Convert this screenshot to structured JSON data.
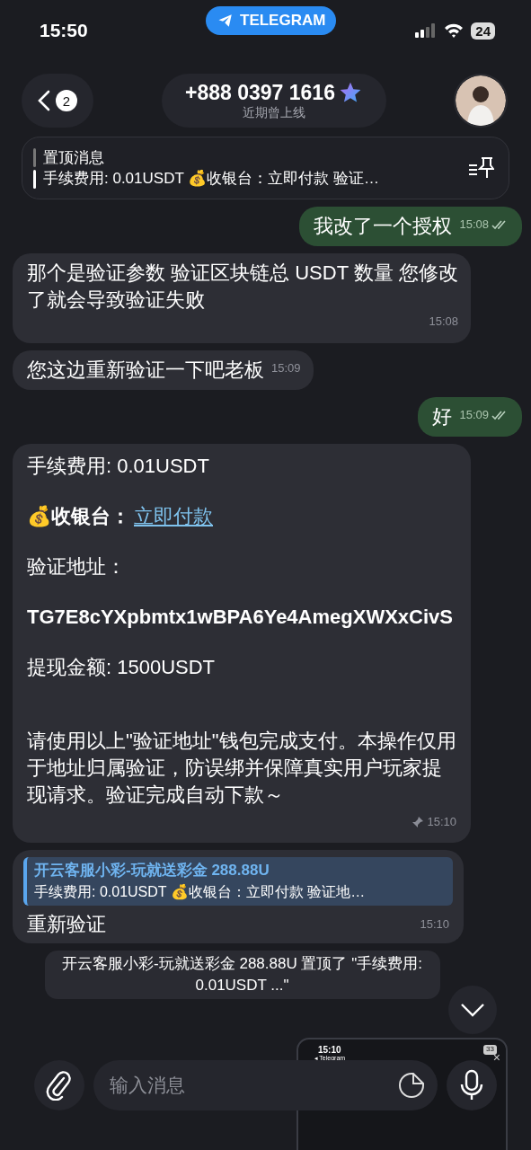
{
  "status_bar": {
    "time": "15:50",
    "app_pill": "TELEGRAM",
    "battery": "24"
  },
  "header": {
    "back_count": "2",
    "title": "+888 0397 1616",
    "subtitle": "近期曾上线"
  },
  "pinned": {
    "label": "置顶消息",
    "text": "手续费用: 0.01USDT 💰收银台：立即付款 验证…"
  },
  "messages": [
    {
      "kind": "text",
      "outgoing": true,
      "text": "我改了一个授权",
      "time": "15:08",
      "read": true
    },
    {
      "kind": "text",
      "outgoing": false,
      "text": "那个是验证参数  验证区块链总 USDT 数量 您修改了就会导致验证失败",
      "time": "15:08"
    },
    {
      "kind": "text",
      "outgoing": false,
      "text": "您这边重新验证一下吧老板",
      "time": "15:09"
    },
    {
      "kind": "text",
      "outgoing": true,
      "text": "好",
      "time": "15:09",
      "read": true
    },
    {
      "kind": "card",
      "pinned": true,
      "time": "15:10",
      "paragraphs": [
        {
          "kind": "plain",
          "text": "手续费用: 0.01USDT"
        },
        {
          "kind": "cashier",
          "label": "💰收银台：",
          "link": "立即付款"
        },
        {
          "kind": "plain",
          "text": "验证地址："
        },
        {
          "kind": "bold",
          "text": "TG7E8cYXpbmtx1wBPA6Ye4AmegXWXxCivS"
        },
        {
          "kind": "plain",
          "text": "提现金额: 1500USDT"
        },
        {
          "kind": "spaced",
          "text": "请使用以上\"验证地址\"钱包完成支付。本操作仅用于地址归属验证，防误绑并保障真实用户玩家提现请求。验证完成自动下款～"
        }
      ]
    },
    {
      "kind": "reply",
      "reply_author": "开云客服小彩-玩就送彩金 288.88U",
      "reply_text": "手续费用: 0.01USDT 💰收银台：立即付款 验证地…",
      "text": "重新验证",
      "time": "15:10"
    },
    {
      "kind": "service",
      "text": "开云客服小彩-玩就送彩金 288.88U 置顶了 \"手续费用: 0.01USDT ...\""
    }
  ],
  "screenshot_preview": {
    "time": "15:10",
    "app": "◂ Telegram",
    "battery": "33",
    "close": "×"
  },
  "composer": {
    "placeholder": "输入消息"
  }
}
